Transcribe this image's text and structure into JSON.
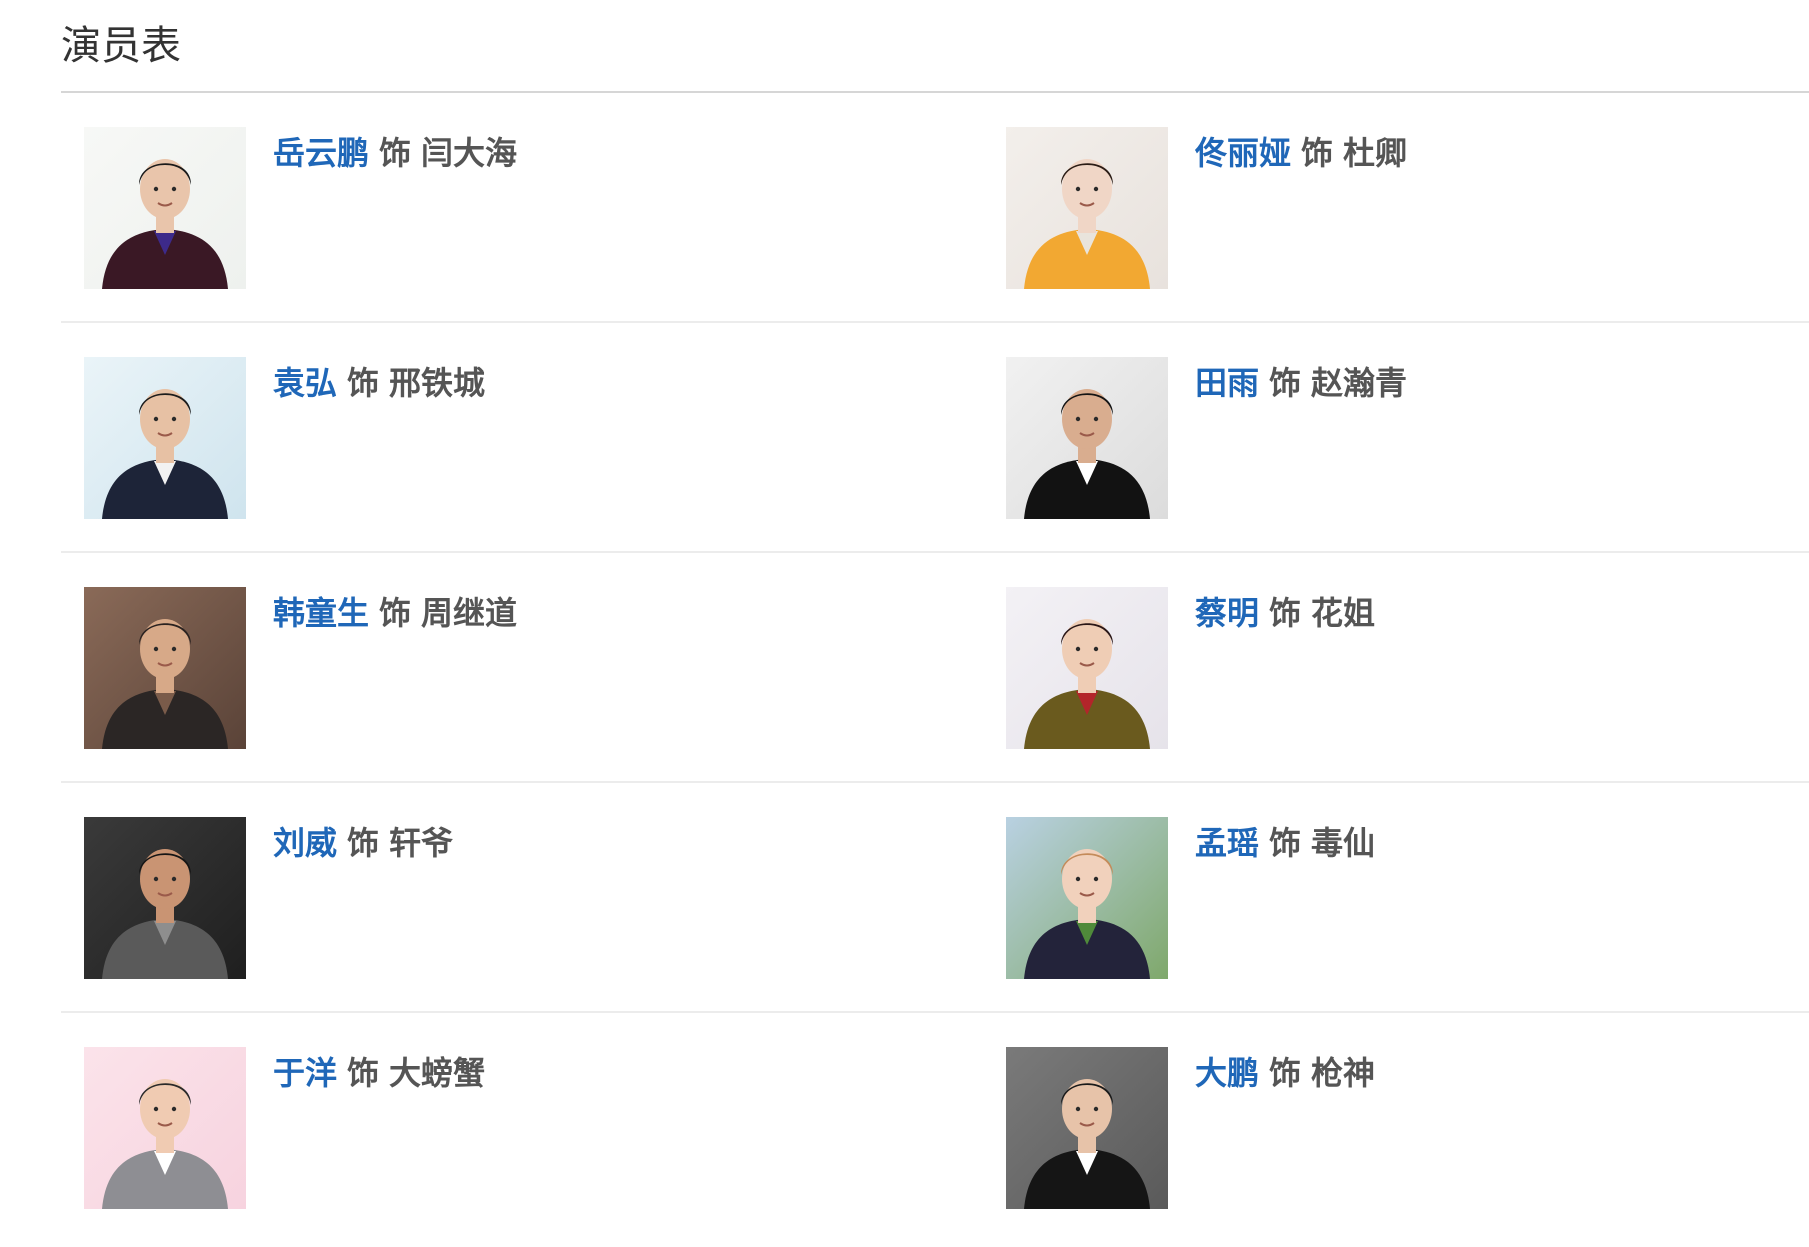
{
  "section": {
    "title": "演员表"
  },
  "cast": [
    {
      "actor": "岳云鹏",
      "as": "饰",
      "role": "闫大海",
      "photo": {
        "bg": "#eef1ee",
        "bg2": "#f7f8f6",
        "skin": "#e9c5ab",
        "hair": "#1a1a1a",
        "clothes": "#3a1825",
        "accent": "#3d2a8a"
      }
    },
    {
      "actor": "佟丽娅",
      "as": "饰",
      "role": "杜卿",
      "photo": {
        "bg": "#e8e2dd",
        "bg2": "#f3efeb",
        "skin": "#f0d6c6",
        "hair": "#2b1c15",
        "clothes": "#f2a832",
        "accent": "#e9e4dc"
      }
    },
    {
      "actor": "袁弘",
      "as": "饰",
      "role": "邢铁城",
      "photo": {
        "bg": "#cfe4ee",
        "bg2": "#eaf4f8",
        "skin": "#e7c1a4",
        "hair": "#1c1c1c",
        "clothes": "#1d2438",
        "accent": "#f2f2f2"
      }
    },
    {
      "actor": "田雨",
      "as": "饰",
      "role": "赵瀚青",
      "photo": {
        "bg": "#dcdcdc",
        "bg2": "#f1f1f1",
        "skin": "#d9ad8f",
        "hair": "#141414",
        "clothes": "#121212",
        "accent": "#ffffff"
      }
    },
    {
      "actor": "韩童生",
      "as": "饰",
      "role": "周继道",
      "photo": {
        "bg": "#5a4338",
        "bg2": "#8a6a58",
        "skin": "#d7a988",
        "hair": "#2a2220",
        "clothes": "#2b2625",
        "accent": "#7a5b4a"
      }
    },
    {
      "actor": "蔡明",
      "as": "饰",
      "role": "花姐",
      "photo": {
        "bg": "#e6e3ea",
        "bg2": "#f3f1f5",
        "skin": "#efcdb5",
        "hair": "#2a1616",
        "clothes": "#6a5a1e",
        "accent": "#b3252a"
      }
    },
    {
      "actor": "刘威",
      "as": "饰",
      "role": "轩爷",
      "photo": {
        "bg": "#1f1f1f",
        "bg2": "#3a3a3a",
        "skin": "#c99473",
        "hair": "#151515",
        "clothes": "#5a5a5a",
        "accent": "#8e8e8e"
      }
    },
    {
      "actor": "孟瑶",
      "as": "饰",
      "role": "毒仙",
      "photo": {
        "bg": "#7fa86b",
        "bg2": "#b9d1e2",
        "skin": "#f1d1bc",
        "hair": "#c48b5a",
        "clothes": "#23233a",
        "accent": "#4f8a3a"
      }
    },
    {
      "actor": "于洋",
      "as": "饰",
      "role": "大螃蟹",
      "photo": {
        "bg": "#f7d3df",
        "bg2": "#fbe3ea",
        "skin": "#f0cbb2",
        "hair": "#2a2a2a",
        "clothes": "#8e8e93",
        "accent": "#ffffff"
      }
    },
    {
      "actor": "大鹏",
      "as": "饰",
      "role": "枪神",
      "photo": {
        "bg": "#5a5a5a",
        "bg2": "#7a7a7a",
        "skin": "#e7c3a9",
        "hair": "#1a1a1a",
        "clothes": "#151515",
        "accent": "#ffffff"
      }
    }
  ]
}
